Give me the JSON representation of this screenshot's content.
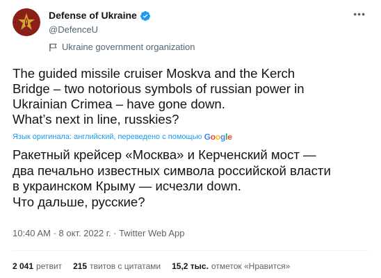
{
  "author": {
    "name": "Defense of Ukraine",
    "handle": "@DefenceU",
    "label": "Ukraine government organization",
    "avatar_color": "#8a1f17",
    "verified_color": "#1d9bf0"
  },
  "more_icon": "more-horizontal-icon",
  "tweet": {
    "text_en": "The guided missile cruiser Moskva and the Kerch\nBridge – two notorious symbols of russian power in\nUkrainian Crimea – have gone down.\nWhat’s next in line, russkies?",
    "translation_note": "Язык оригинала: английский, переведено с помощью",
    "translation_provider": "Google",
    "text_ru": "Ракетный крейсер «Москва» и Керченский мост —\nдва печально известных символа российской власти\nв украинском Крыму — исчезли down.\nЧто дальше, русские?"
  },
  "meta": {
    "time": "10:40 AM",
    "separator": "·",
    "date": "8 окт. 2022 г.",
    "source": "Twitter Web App"
  },
  "stats": [
    {
      "num": "2 041",
      "label": "ретвит"
    },
    {
      "num": "215",
      "label": "твитов с цитатами"
    },
    {
      "num": "15,2 тыс.",
      "label": "отметок «Нравится»"
    }
  ]
}
